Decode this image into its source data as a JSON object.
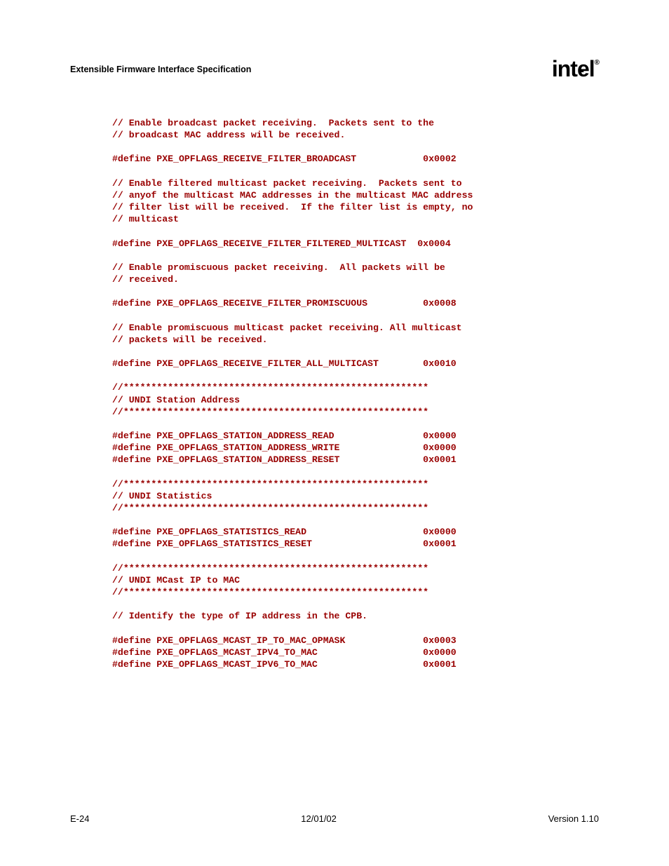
{
  "header": {
    "title": "Extensible Firmware Interface Specification",
    "logo": "intel"
  },
  "code": {
    "c1": "// Enable broadcast packet receiving.  Packets sent to the",
    "c2": "// broadcast MAC address will be received.",
    "d1": "#define PXE_OPFLAGS_RECEIVE_FILTER_BROADCAST            0x0002",
    "c3": "// Enable filtered multicast packet receiving.  Packets sent to",
    "c4": "// anyof the multicast MAC addresses in the multicast MAC address",
    "c5": "// filter list will be received.  If the filter list is empty, no",
    "c6": "// multicast",
    "d2": "#define PXE_OPFLAGS_RECEIVE_FILTER_FILTERED_MULTICAST  0x0004",
    "c7": "// Enable promiscuous packet receiving.  All packets will be",
    "c8": "// received.",
    "d3": "#define PXE_OPFLAGS_RECEIVE_FILTER_PROMISCUOUS          0x0008",
    "c9": "// Enable promiscuous multicast packet receiving. All multicast",
    "c10": "// packets will be received.",
    "d4": "#define PXE_OPFLAGS_RECEIVE_FILTER_ALL_MULTICAST        0x0010",
    "sep1": "//*******************************************************",
    "h1": "// UNDI Station Address",
    "sep2": "//*******************************************************",
    "d5": "#define PXE_OPFLAGS_STATION_ADDRESS_READ                0x0000",
    "d6": "#define PXE_OPFLAGS_STATION_ADDRESS_WRITE               0x0000",
    "d7": "#define PXE_OPFLAGS_STATION_ADDRESS_RESET               0x0001",
    "sep3": "//*******************************************************",
    "h2": "// UNDI Statistics",
    "sep4": "//*******************************************************",
    "d8": "#define PXE_OPFLAGS_STATISTICS_READ                     0x0000",
    "d9": "#define PXE_OPFLAGS_STATISTICS_RESET                    0x0001",
    "sep5": "//*******************************************************",
    "h3": "// UNDI MCast IP to MAC",
    "sep6": "//*******************************************************",
    "c11": "// Identify the type of IP address in the CPB.",
    "d10": "#define PXE_OPFLAGS_MCAST_IP_TO_MAC_OPMASK              0x0003",
    "d11": "#define PXE_OPFLAGS_MCAST_IPV4_TO_MAC                   0x0000",
    "d12": "#define PXE_OPFLAGS_MCAST_IPV6_TO_MAC                   0x0001"
  },
  "footer": {
    "left": "E-24",
    "center": "12/01/02",
    "right": "Version 1.10"
  }
}
